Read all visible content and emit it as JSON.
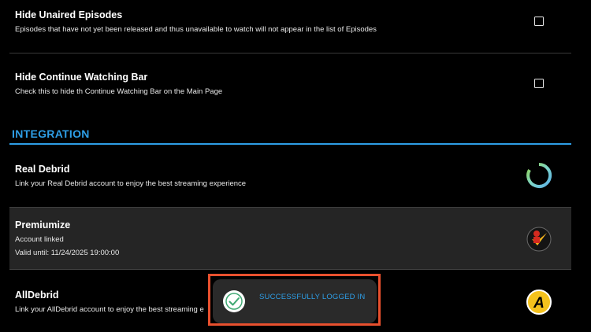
{
  "settings": {
    "hide_unaired": {
      "title": "Hide Unaired Episodes",
      "description": "Episodes that have not yet been released and thus unavailable to watch will not appear in the list of Episodes",
      "checked": false
    },
    "hide_continue": {
      "title": "Hide Continue Watching Bar",
      "description": "Check this to hide th Continue Watching Bar on the Main Page",
      "checked": false
    }
  },
  "integration": {
    "section_title": "INTEGRATION",
    "items": [
      {
        "title": "Real Debrid",
        "description": "Link your Real Debrid account to enjoy the best streaming experience",
        "icon": "real-debrid-logo-icon"
      },
      {
        "title": "Premiumize",
        "status": "Account linked",
        "valid_until": "Valid until: 11/24/2025 19:00:00",
        "icon": "premiumize-logo-icon"
      },
      {
        "title": "AllDebrid",
        "description": "Link your AllDebrid account to enjoy the best streaming e",
        "icon": "alldebrid-logo-icon"
      }
    ]
  },
  "toast": {
    "message": "SUCCESSFULLY LOGGED IN",
    "icon": "check-circle-icon"
  },
  "colors": {
    "accent": "#2e9ee6",
    "highlight_border": "#e8502e",
    "background": "#000000",
    "selected_row": "#252525"
  }
}
